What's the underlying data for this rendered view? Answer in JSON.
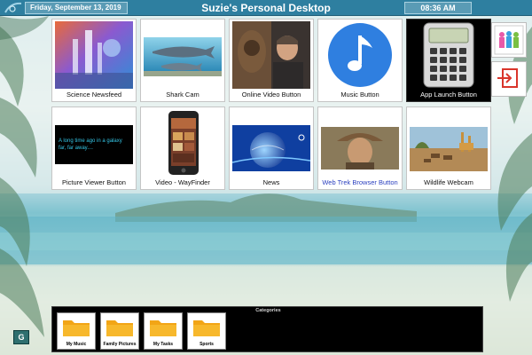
{
  "header": {
    "date": "Friday, September 13, 2019",
    "title": "Suzie's Personal Desktop",
    "time": "08:36 AM"
  },
  "tiles": [
    {
      "label": "Science Newsfeed",
      "icon": "science-newsfeed-thumbnail"
    },
    {
      "label": "Shark Cam",
      "icon": "shark-cam-thumbnail"
    },
    {
      "label": "Online Video Button",
      "icon": "online-video-thumbnail"
    },
    {
      "label": "Music Button",
      "icon": "music-note-icon"
    },
    {
      "label": "App Launch Button",
      "icon": "calculator-icon"
    },
    {
      "label": "Picture Viewer Button",
      "icon": "picture-viewer-thumbnail",
      "thumb_text": "A long time ago in a galaxy far, far away...."
    },
    {
      "label": "Video - WayFinder",
      "icon": "phone-video-thumbnail"
    },
    {
      "label": "News",
      "icon": "news-globe-thumbnail"
    },
    {
      "label": "Web Trek Browser Button",
      "icon": "web-trek-thumbnail"
    },
    {
      "label": "Wildlife Webcam",
      "icon": "wildlife-webcam-thumbnail"
    }
  ],
  "side_buttons": [
    {
      "name": "people-icon"
    },
    {
      "name": "logout-icon"
    }
  ],
  "categories": {
    "title": "Categories",
    "folders": [
      {
        "label": "My Music"
      },
      {
        "label": "Family Pictures"
      },
      {
        "label": "My Tasks"
      },
      {
        "label": "Sports"
      }
    ]
  },
  "bottom_button": {
    "text": "G"
  },
  "colors": {
    "topbar": "#2e7fa0",
    "music_blue": "#2f7fe0",
    "link_text": "#2a3fbf",
    "folder_yellow": "#f2a516"
  }
}
